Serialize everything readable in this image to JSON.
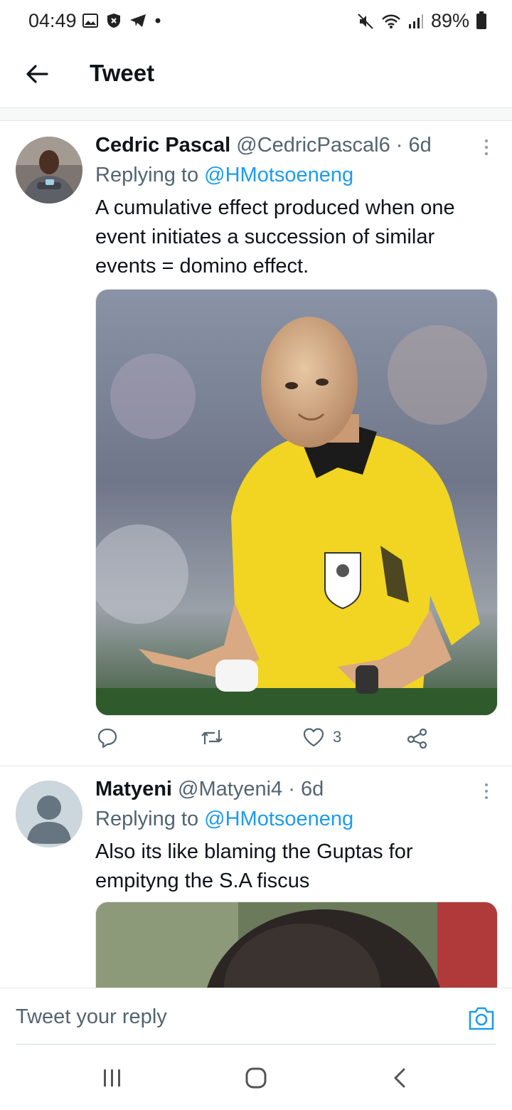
{
  "status_bar": {
    "time": "04:49",
    "battery": "89%",
    "left_icons": [
      "gallery-icon",
      "shield-icon",
      "telegram-icon",
      "dot-icon"
    ],
    "right_icons": [
      "mute-icon",
      "wifi-icon",
      "signal-icon",
      "battery-icon"
    ]
  },
  "header": {
    "title": "Tweet",
    "back_icon": "arrow-left-icon"
  },
  "tweets": [
    {
      "name": "Cedric Pascal",
      "handle": "@CedricPascal6",
      "dot": "·",
      "time": "6d",
      "replying_prefix": "Replying to",
      "replying_to": "@HMotsoeneng",
      "text": "A cumulative effect produced when one event initiates a succession of similar events = domino effect.",
      "likes": "3"
    },
    {
      "name": "Matyeni",
      "handle": "@Matyeni4",
      "dot": "·",
      "time": "6d",
      "replying_prefix": "Replying to",
      "replying_to": "@HMotsoeneng",
      "text": "Also its like blaming the Guptas for empityng the S.A fiscus"
    }
  ],
  "reply_bar": {
    "placeholder": "Tweet your reply",
    "camera_icon": "camera-icon"
  },
  "nav_bar": {
    "icons": [
      "recent-apps-icon",
      "home-icon",
      "back-icon"
    ]
  },
  "colors": {
    "accent": "#1d9bf0",
    "secondary_text": "#536471",
    "referee_shirt": "#f2d422"
  }
}
